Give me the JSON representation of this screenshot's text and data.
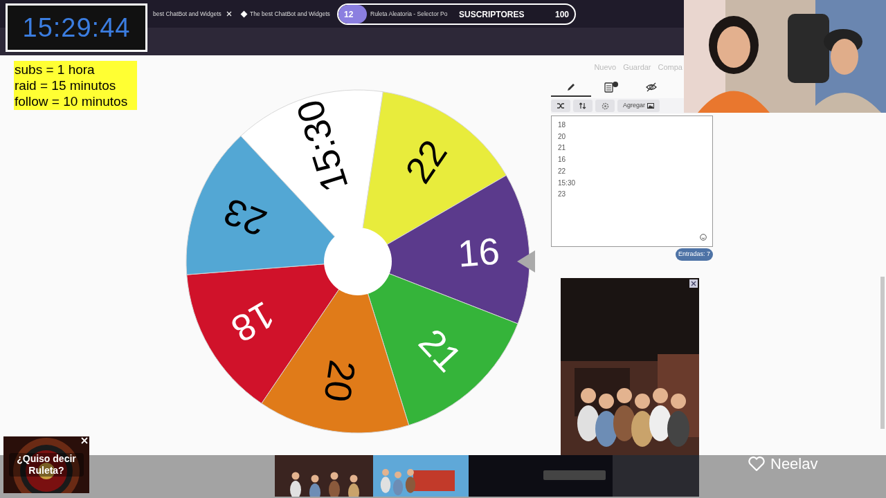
{
  "timer": {
    "text": "15:29:44"
  },
  "browser_tabs": [
    {
      "label": "best ChatBot and Widgets",
      "kind": "closable"
    },
    {
      "label": "The best ChatBot and Widgets",
      "kind": "favicon"
    },
    {
      "label": "Ruleta Aleatoria - Selector Po",
      "kind": "plain"
    }
  ],
  "subs_goal": {
    "current": "12",
    "label": "SUSCRIPTORES",
    "goal": "100",
    "level": 0.12
  },
  "rules_note": [
    "subs = 1 hora",
    "raid = 15 minutos",
    "follow = 10 minutos"
  ],
  "wheel": {
    "segments": [
      {
        "label": "15:30",
        "color": "#ffffff"
      },
      {
        "label": "22",
        "color": "#e8ec3c"
      },
      {
        "label": "16",
        "color": "#5b3a8c"
      },
      {
        "label": "21",
        "color": "#35b43a"
      },
      {
        "label": "20",
        "color": "#e07b19"
      },
      {
        "label": "18",
        "color": "#d0122a"
      },
      {
        "label": "23",
        "color": "#53a7d4"
      }
    ]
  },
  "toolbar_links": [
    "Nuevo",
    "Guardar",
    "Compa"
  ],
  "panel_tabs": [
    {
      "kind": "pencil",
      "selected": true
    },
    {
      "kind": "clipboard",
      "selected": false
    },
    {
      "kind": "eye-off",
      "selected": false
    }
  ],
  "panel_buttons": [
    {
      "kind": "shuffle"
    },
    {
      "kind": "sort"
    },
    {
      "kind": "gear"
    },
    {
      "kind": "add-image",
      "label": "Agregar"
    }
  ],
  "entries": [
    "18",
    "20",
    "21",
    "16",
    "22",
    "15:30",
    "23"
  ],
  "entries_count": "Entradas: 7",
  "promo": {
    "text": "¿Quiso decir Ruleta?"
  },
  "follower": {
    "name": "Neelav"
  }
}
